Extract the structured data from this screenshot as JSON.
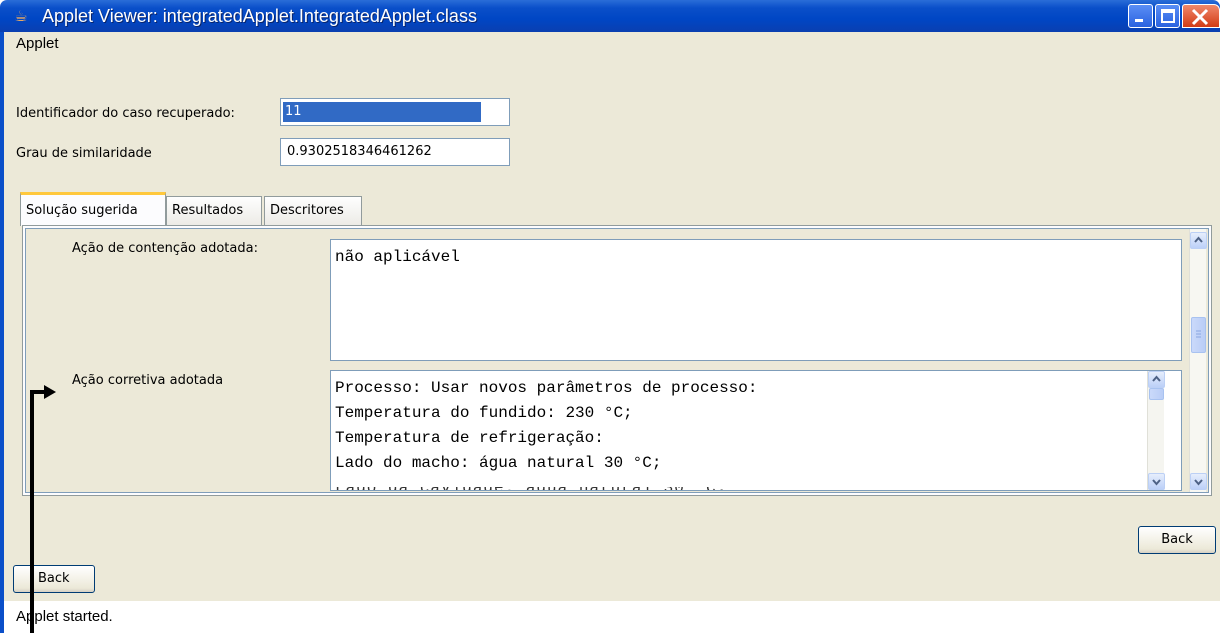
{
  "window": {
    "title": "Applet Viewer: integratedApplet.IntegratedApplet.class",
    "icon": "java-cup-icon",
    "accent": "#0a4fc9"
  },
  "menubar": {
    "items": [
      "Applet"
    ]
  },
  "form": {
    "case_id_label": "Identificador do caso recuperado:",
    "case_id_value": "11",
    "similarity_label": "Grau de similaridade",
    "similarity_value": "0.9302518346461262"
  },
  "tabs": [
    {
      "label": "Solução sugerida",
      "active": true
    },
    {
      "label": "Resultados",
      "active": false
    },
    {
      "label": "Descritores",
      "active": false
    }
  ],
  "panel": {
    "containment_label": "Ação de contenção adotada:",
    "containment_text": "não aplicável",
    "corrective_label": "Ação corretiva adotada",
    "corrective_lines": [
      "Processo: Usar novos parâmetros de processo:",
      "Temperatura do fundido: 230 °C;",
      "Temperatura de refrigeração:",
      "Lado do macho: água natural 30 °C;"
    ]
  },
  "buttons": {
    "back_right": "Back",
    "back_left": "Back"
  },
  "status": {
    "text": "Applet started."
  }
}
